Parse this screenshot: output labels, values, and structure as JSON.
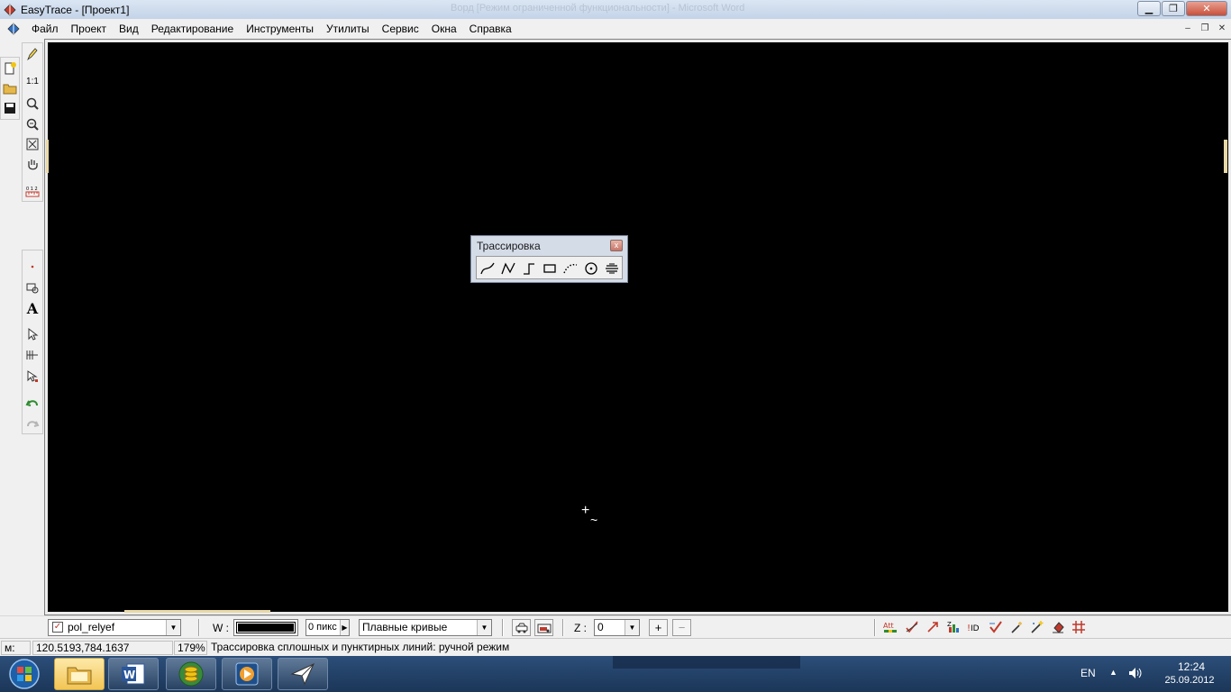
{
  "window": {
    "title": "EasyTrace - [Проект1]",
    "ghost_title": "Ворд [Режим ограниченной функциональности] - Microsoft Word"
  },
  "menu": {
    "items": [
      "Файл",
      "Проект",
      "Вид",
      "Редактирование",
      "Инструменты",
      "Утилиты",
      "Сервис",
      "Окна",
      "Справка"
    ]
  },
  "left_toolbar": {
    "scale_label": "1:1"
  },
  "palette": {
    "title": "Трассировка",
    "close_label": "x",
    "tools": [
      "smooth-curve-icon",
      "polyline-icon",
      "orthogonal-line-icon",
      "rectangle-icon",
      "dotted-curve-icon",
      "circle-icon",
      "hatch-icon"
    ]
  },
  "bottom_toolbar": {
    "layer_name": "pol_relyef",
    "layer_checked": true,
    "width_label": "W :",
    "width_value": "0 пикс",
    "curve_mode": "Плавные кривые",
    "z_label": "Z :",
    "z_value": "0",
    "plus_label": "+",
    "minus_label": "−",
    "right_icons": [
      "attributes-icon",
      "check-lines-icon",
      "arrow-up-icon",
      "z-values-icon",
      "id-icon",
      "validate-icon",
      "magic-wand-icon",
      "wand-star-icon",
      "fill-icon",
      "grid-icon"
    ],
    "att_label": "Att",
    "id_label": "ID"
  },
  "status": {
    "mode_label": "м:",
    "coordinates": "120.5193,784.1637",
    "zoom": "179%",
    "message": "Трассировка сплошных и пунктирных линий: ручной режим"
  },
  "taskbar": {
    "language": "EN",
    "time": "12:24",
    "date": "25.09.2012",
    "apps": [
      "file-explorer-icon",
      "word-icon",
      "coins-icon",
      "media-icon",
      "easytrace-icon"
    ]
  },
  "colors": {
    "canvas": "#000000",
    "taskbar": "#1f3b60",
    "accent_marker": "#e9d9a8"
  }
}
